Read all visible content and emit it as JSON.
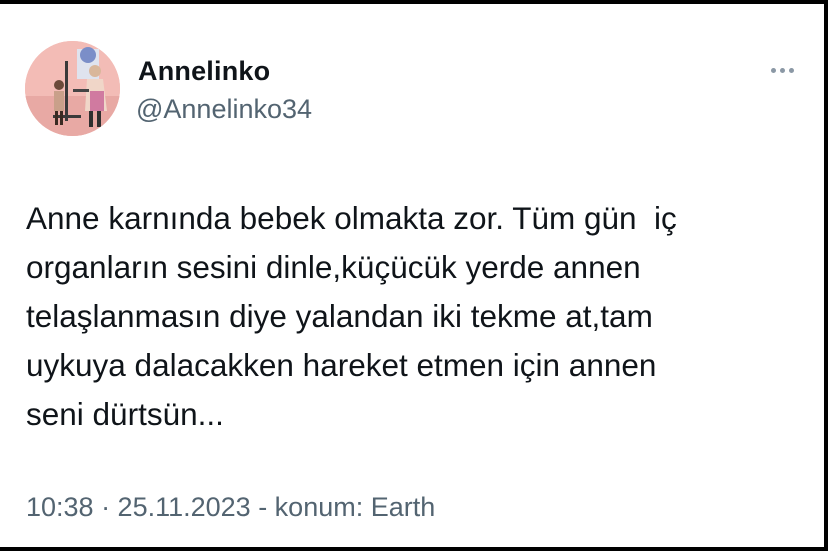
{
  "tweet": {
    "author": {
      "display_name": "Annelinko",
      "handle": "@Annelinko34",
      "avatar": "profile-photo"
    },
    "more_icon": "more-horizontal-icon",
    "text": "Anne karnında bebek olmakta zor. Tüm gün  iç\norganların sesini dinle,küçücük yerde annen\ntelaşlanmasın diye yalandan iki tekme at,tam\nuykuya dalacakken hareket etmen için annen\nseni dürtsün...",
    "meta": "10:38 · 25.11.2023 - konum: Earth"
  },
  "colors": {
    "text": "#0f1419",
    "secondary": "#536471",
    "frame": "#000000",
    "avatar_background": "#f2b9b4"
  }
}
